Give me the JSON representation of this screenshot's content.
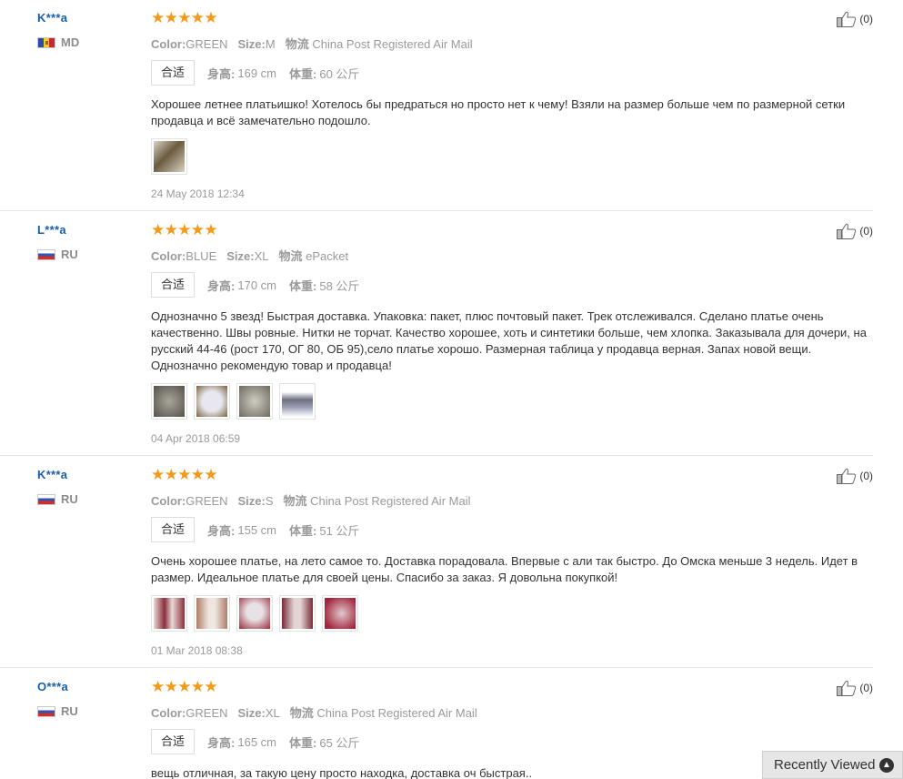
{
  "reviews": [
    {
      "user": "K***a",
      "country": "MD",
      "flag": "md",
      "rating": 5,
      "color_label": "Color:",
      "color_value": "GREEN",
      "size_label": "Size:",
      "size_value": "M",
      "ship_label": "物流",
      "ship_value": "China Post Registered Air Mail",
      "fit": "合适",
      "height_label": "身高:",
      "height_value": "169 cm",
      "weight_label": "体重:",
      "weight_value": "60 公斤",
      "text": "Хорошее летнее платьишко! Хотелось бы предраться но просто нет к чему! Взяли на размер больше чем по размерной сетки продавца и всё замечательно подошло.",
      "date": "24 May 2018 12:34",
      "likes": "(0)",
      "thumbs": [
        [
          "#6b5a3e",
          "#d9d3c4"
        ]
      ]
    },
    {
      "user": "L***a",
      "country": "RU",
      "flag": "ru",
      "rating": 5,
      "color_label": "Color:",
      "color_value": "BLUE",
      "size_label": "Size:",
      "size_value": "XL",
      "ship_label": "物流",
      "ship_value": "ePacket",
      "fit": "合适",
      "height_label": "身高:",
      "height_value": "170 cm",
      "weight_label": "体重:",
      "weight_value": "58 公斤",
      "text": "Однозначно 5 звезд! Быстрая доставка. Упаковка: пакет, плюс почтовый пакет. Трек отслеживался. Сделано платье очень качественно. Швы ровные. Нитки не торчат. Качество хорошее, хоть и синтетики больше, чем хлопка. Заказывала для дочери, на русский 44-46 (рост 170, ОГ 80, ОБ 95),село платье хорошо. Размерная таблица у продавца верная. Запах новой вещи. Однозначно рекомендую товар и продавца!",
      "date": "04 Apr 2018 06:59",
      "likes": "(0)",
      "thumbs": [
        [
          "#5d5a52",
          "#a9a59b"
        ],
        [
          "#7a6441",
          "#e8e6ee"
        ],
        [
          "#6d6a60",
          "#cfcbc2"
        ],
        [
          "#ffffff",
          "#6e6f80"
        ]
      ]
    },
    {
      "user": "K***a",
      "country": "RU",
      "flag": "ru",
      "rating": 5,
      "color_label": "Color:",
      "color_value": "GREEN",
      "size_label": "Size:",
      "size_value": "S",
      "ship_label": "物流",
      "ship_value": "China Post Registered Air Mail",
      "fit": "合适",
      "height_label": "身高:",
      "height_value": "155 cm",
      "weight_label": "体重:",
      "weight_value": "51 公斤",
      "text": "Очень хорошее платье, на лето самое то. Доставка порадовала. Впервые с али так быстро. До Омска меньше 3 недель. Идет в размер. Идеальное платье для своей цены. Спасибо за заказ. Я довольна покупкой!",
      "date": "01 Mar 2018 08:38",
      "likes": "(0)",
      "thumbs": [
        [
          "#8a2f3c",
          "#e9d9d6"
        ],
        [
          "#b07e6a",
          "#efe7df"
        ],
        [
          "#9b2a3a",
          "#e8e2e6"
        ],
        [
          "#7a2b36",
          "#e3d5d5"
        ],
        [
          "#a3263c",
          "#dfc9cf"
        ]
      ]
    },
    {
      "user": "O***a",
      "country": "RU",
      "flag": "ru",
      "rating": 5,
      "color_label": "Color:",
      "color_value": "GREEN",
      "size_label": "Size:",
      "size_value": "XL",
      "ship_label": "物流",
      "ship_value": "China Post Registered Air Mail",
      "fit": "合适",
      "height_label": "身高:",
      "height_value": "165 cm",
      "weight_label": "体重:",
      "weight_value": "65 公斤",
      "text": "вещь отличная, за такую цену просто находка, доставка оч быстрая..",
      "date": "",
      "likes": "(0)",
      "thumbs": []
    }
  ],
  "recently_viewed": {
    "label": "Recently Viewed",
    "icon": "chevron-up-icon"
  },
  "colors": {
    "star": "#f39a1a",
    "username": "#1a5ea7",
    "meta": "#9a9a9a"
  }
}
